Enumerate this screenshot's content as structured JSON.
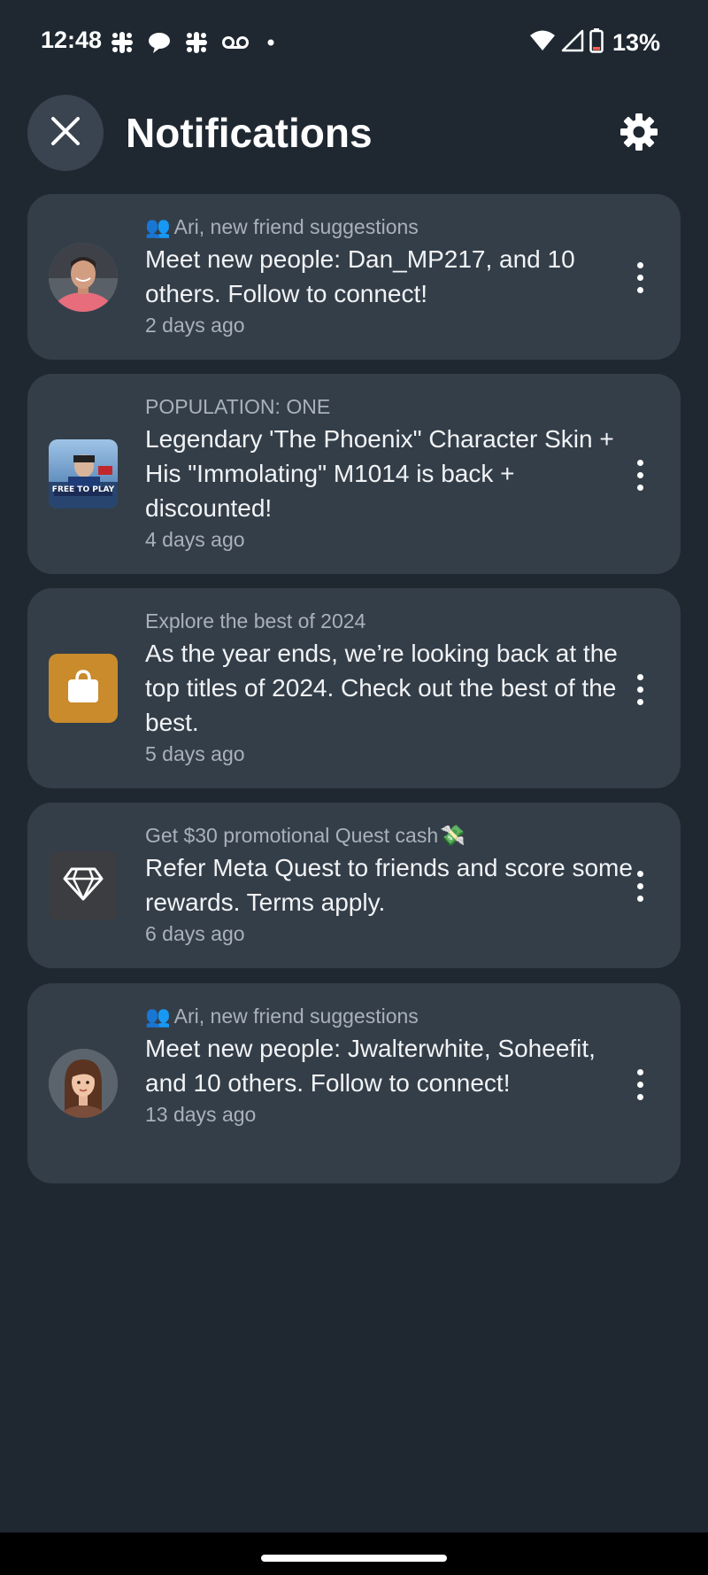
{
  "status_bar": {
    "time": "12:48",
    "left_icons": [
      "slack-icon",
      "chat-bubble-icon",
      "slack-icon",
      "voicemail-icon",
      "dot-icon"
    ],
    "right_icons": [
      "wifi-icon",
      "cellular-signal-icon",
      "battery-icon"
    ],
    "battery_percent": "13%",
    "battery_color": "#ff5c4d"
  },
  "header": {
    "title": "Notifications",
    "close_icon": "close-icon",
    "settings_icon": "gear-icon"
  },
  "notifications": [
    {
      "source": "Ari, new friend suggestions",
      "source_emoji": "👥",
      "body": "Meet new people: Dan_MP217, and 10 others. Follow to connect!",
      "time": "2 days ago",
      "thumbnail": "user-avatar-photo"
    },
    {
      "source": "POPULATION: ONE",
      "body": "Legendary 'The Phoenix\" Character Skin + His \"Immolating\" M1014 is back + discounted!",
      "time": "4 days ago",
      "thumbnail": "game-thumbnail",
      "thumbnail_text": "FREE TO PLAY"
    },
    {
      "source": "Explore the best of 2024",
      "body": "As the year ends, we’re looking back at the top titles of 2024. Check out the best of the best.",
      "time": "5 days ago",
      "thumbnail": "shopping-bag-icon",
      "thumbnail_color": "#c98b2b"
    },
    {
      "source": "Get $30 promotional Quest cash",
      "source_emoji_after": "💸",
      "body": "Refer Meta Quest to friends and score some rewards. Terms apply.",
      "time": "6 days ago",
      "thumbnail": "diamond-icon"
    },
    {
      "source": "Ari, new friend suggestions",
      "source_emoji": "👥",
      "body": "Meet new people: Jwalterwhite, Soheefit, and 10 others. Follow to connect!",
      "time": "13 days ago",
      "thumbnail": "user-avatar-illustrated"
    }
  ],
  "colors": {
    "background": "#1f2831",
    "card": "#343e49",
    "secondary_text": "#a9b1ba"
  }
}
